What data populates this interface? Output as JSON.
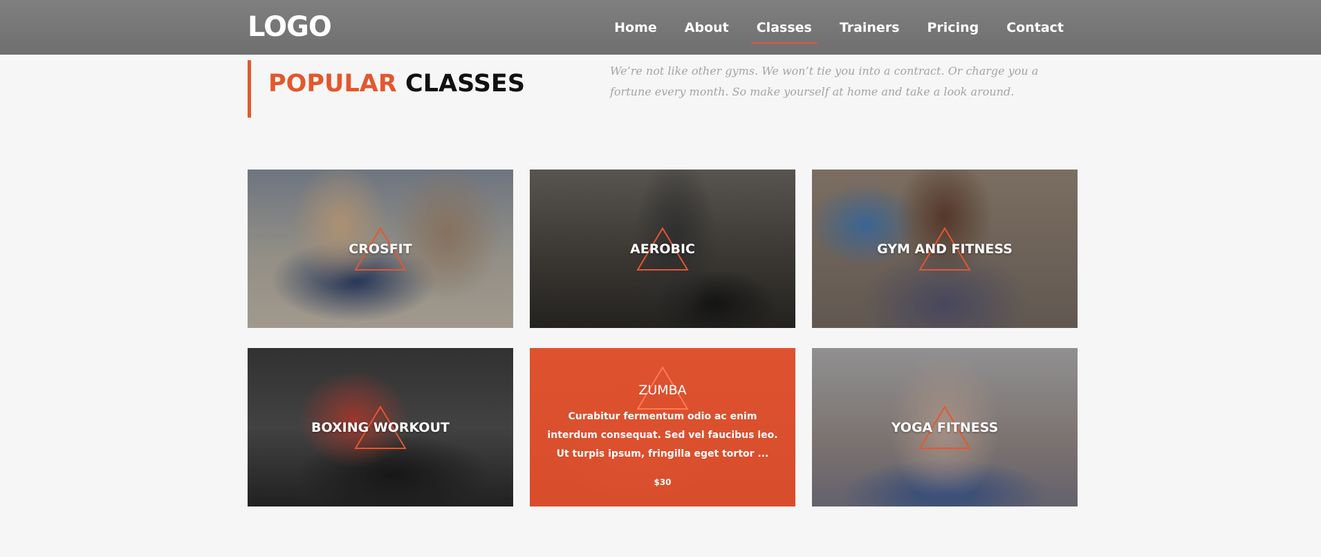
{
  "header": {
    "logo": "LOGO",
    "nav": [
      {
        "label": "Home"
      },
      {
        "label": "About"
      },
      {
        "label": "Classes",
        "active": true
      },
      {
        "label": "Trainers"
      },
      {
        "label": "Pricing"
      },
      {
        "label": "Contact"
      }
    ]
  },
  "section": {
    "title_highlight": "POPULAR",
    "title_rest": "CLASSES",
    "intro": "We’re not like other gyms. We won’t tie you into a contract. Or charge you a fortune every month. So make yourself at home and take a look around."
  },
  "classes": [
    {
      "title": "CROSFIT"
    },
    {
      "title": "AEROBIC"
    },
    {
      "title": "GYM AND FITNESS"
    },
    {
      "title": "BOXING WORKOUT"
    },
    {
      "title": "ZUMBA",
      "description": "Curabitur fermentum odio ac enim interdum consequat. Sed vel faucibus leo. Ut turpis ipsum, fringilla eget tortor ...",
      "price": "$30"
    },
    {
      "title": "YOGA FITNESS"
    }
  ],
  "colors": {
    "accent": "#e4572e",
    "header_bg": "#7a7a7a",
    "page_bg": "#f6f6f6"
  },
  "icons": {
    "card_emblem": "triangle-outline-icon"
  }
}
